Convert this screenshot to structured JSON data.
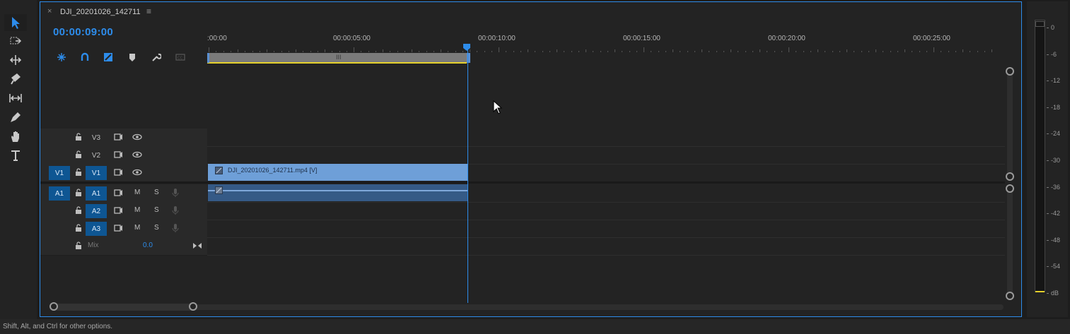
{
  "window": {
    "tab_close": "×",
    "sequence_title": "DJI_20201026_142711",
    "tab_menu": "≡"
  },
  "timecode": "00:00:09:00",
  "ruler": {
    "labels": [
      ":00:00",
      "00:00:05:00",
      "00:00:10:00",
      "00:00:15:00",
      "00:00:20:00",
      "00:00:25:00"
    ]
  },
  "tools": [
    "selection-tool",
    "track-select-tool",
    "ripple-edit-tool",
    "razor-tool",
    "slip-tool",
    "pen-tool",
    "hand-tool",
    "type-tool"
  ],
  "header_buttons": [
    "snap",
    "linked-selection",
    "add-marker",
    "marker",
    "settings",
    "captions"
  ],
  "tracks": {
    "video": [
      {
        "src": "",
        "name": "V3"
      },
      {
        "src": "",
        "name": "V2"
      },
      {
        "src": "V1",
        "name": "V1"
      }
    ],
    "audio": [
      {
        "src": "A1",
        "name": "A1",
        "m": "M",
        "s": "S"
      },
      {
        "src": "",
        "name": "A2",
        "m": "M",
        "s": "S"
      },
      {
        "src": "",
        "name": "A3",
        "m": "M",
        "s": "S"
      }
    ],
    "mix": {
      "label": "Mix",
      "value": "0.0"
    }
  },
  "clips": {
    "video_clip_label": "DJI_20201026_142711.mp4 [V]"
  },
  "meter": {
    "labels": [
      "0",
      "-6",
      "-12",
      "-18",
      "-24",
      "-30",
      "-36",
      "-42",
      "-48",
      "-54",
      "dB"
    ]
  },
  "status_bar": "Shift, Alt, and Ctrl for other options.",
  "colors": {
    "accent": "#2d8ceb",
    "video_clip": "#6e9fd8",
    "audio_clip": "#355a86",
    "work_area": "#e6d12b",
    "track_target": "#0e5693"
  }
}
